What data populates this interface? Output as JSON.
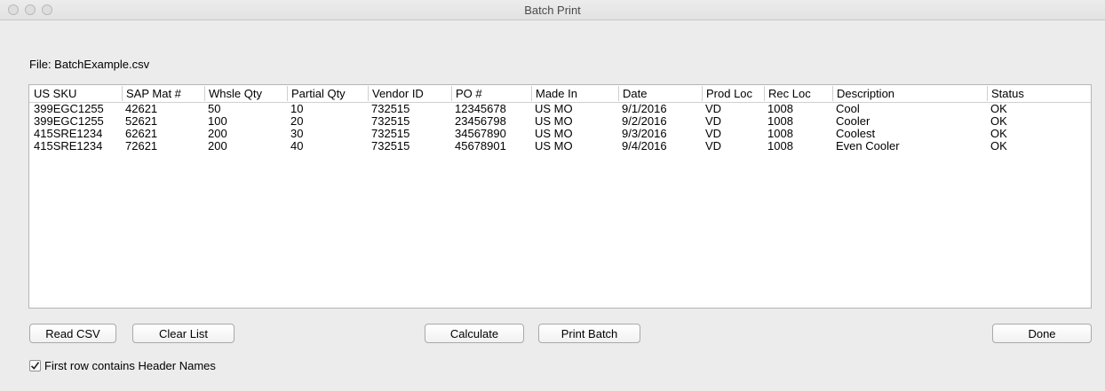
{
  "window": {
    "title": "Batch Print"
  },
  "file": {
    "label": "File: BatchExample.csv"
  },
  "table": {
    "headers": [
      "US SKU",
      "SAP Mat #",
      "Whsle Qty",
      "Partial Qty",
      "Vendor ID",
      "PO #",
      "Made In",
      "Date",
      "Prod Loc",
      "Rec Loc",
      "Description",
      "Status"
    ],
    "rows": [
      [
        "399EGC1255",
        "42621",
        "50",
        "10",
        "732515",
        "12345678",
        "US MO",
        "9/1/2016",
        "VD",
        "1008",
        "Cool",
        "OK"
      ],
      [
        "399EGC1255",
        "52621",
        "100",
        "20",
        "732515",
        "23456798",
        "US MO",
        "9/2/2016",
        "VD",
        "1008",
        "Cooler",
        "OK"
      ],
      [
        "415SRE1234",
        "62621",
        "200",
        "30",
        "732515",
        "34567890",
        "US MO",
        "9/3/2016",
        "VD",
        "1008",
        "Coolest",
        "OK"
      ],
      [
        "415SRE1234",
        "72621",
        "200",
        "40",
        "732515",
        "45678901",
        "US MO",
        "9/4/2016",
        "VD",
        "1008",
        "Even Cooler",
        "OK"
      ]
    ]
  },
  "buttons": {
    "read_csv": "Read CSV",
    "clear_list": "Clear List",
    "calculate": "Calculate",
    "print_batch": "Print Batch",
    "done": "Done"
  },
  "options": {
    "header_checkbox_label": "First row contains Header Names",
    "header_checkbox_checked": true
  }
}
